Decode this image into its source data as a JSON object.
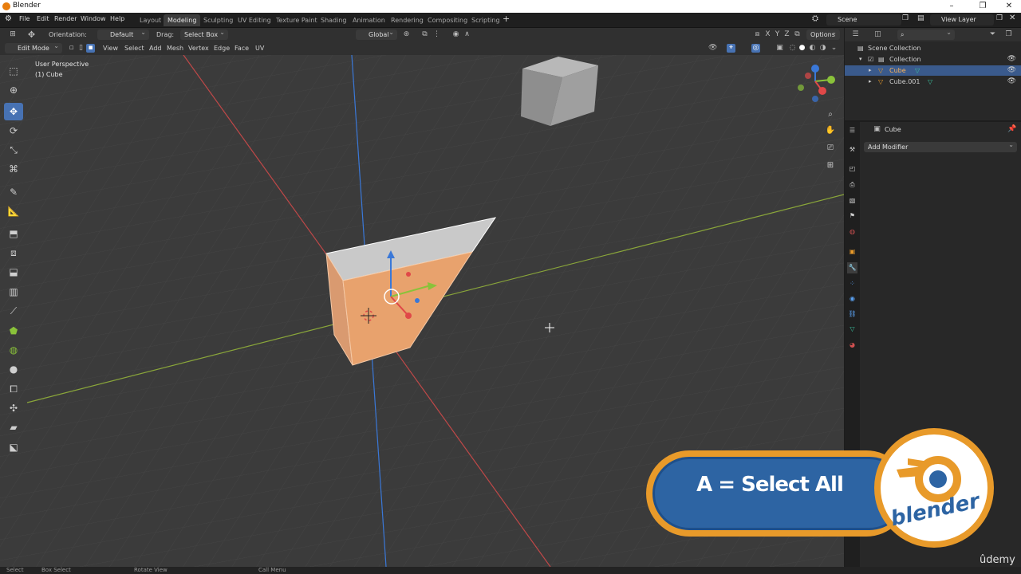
{
  "window": {
    "title": "Blender"
  },
  "menu": [
    "File",
    "Edit",
    "Render",
    "Window",
    "Help"
  ],
  "workspaces": [
    "Layout",
    "Modeling",
    "Sculpting",
    "UV Editing",
    "Texture Paint",
    "Shading",
    "Animation",
    "Rendering",
    "Compositing",
    "Scripting"
  ],
  "active_workspace": "Modeling",
  "scene": "Scene",
  "view_layer": "View Layer",
  "header": {
    "orientation_label": "Orientation:",
    "orientation_value": "Default",
    "drag_label": "Drag:",
    "drag_value": "Select Box",
    "transform_orientation": "Global",
    "options": "Options",
    "mode": "Edit Mode",
    "menus": [
      "View",
      "Select",
      "Add",
      "Mesh",
      "Vertex",
      "Edge",
      "Face",
      "UV"
    ],
    "axis_toggles": [
      "X",
      "Y",
      "Z"
    ]
  },
  "viewport": {
    "perspective": "User Perspective",
    "object": "(1) Cube"
  },
  "outliner": {
    "root": "Scene Collection",
    "collection": "Collection",
    "objects": [
      "Cube",
      "Cube.001"
    ],
    "selected": "Cube"
  },
  "properties": {
    "object_name": "Cube",
    "add_modifier": "Add Modifier"
  },
  "statusbar": [
    "Select",
    "Box Select",
    "Rotate View",
    "Call Menu"
  ],
  "overlay": {
    "hint": "A = Select All",
    "brand": "blender",
    "watermark": "ûdemy"
  },
  "colors": {
    "accent": "#4772b3",
    "selected_face": "#e8a26d",
    "overlay_orange": "#e89a2a",
    "overlay_blue": "#2d64a3"
  }
}
